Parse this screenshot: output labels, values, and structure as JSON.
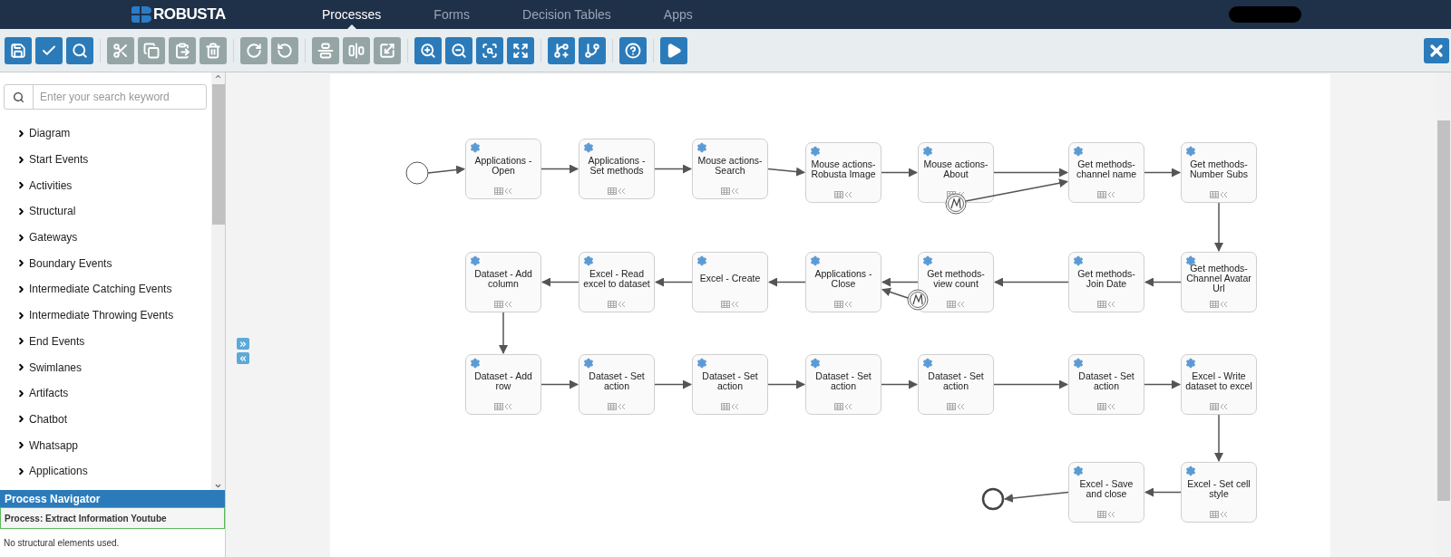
{
  "nav": {
    "brand": "ROBUSTA",
    "tabs": [
      {
        "label": "Processes",
        "selected": true
      },
      {
        "label": "Forms",
        "selected": false
      },
      {
        "label": "Decision Tables",
        "selected": false
      },
      {
        "label": "Apps",
        "selected": false
      }
    ]
  },
  "toolbar": {
    "groups": [
      [
        {
          "disabled": false
        },
        {
          "disabled": false
        },
        {
          "disabled": false
        }
      ],
      [
        {
          "disabled": true
        },
        {
          "disabled": true
        },
        {
          "disabled": true
        },
        {
          "disabled": true
        }
      ],
      [
        {
          "disabled": true
        },
        {
          "disabled": true
        }
      ],
      [
        {
          "disabled": true
        },
        {
          "disabled": true
        },
        {
          "disabled": true
        }
      ],
      [
        {
          "disabled": false
        },
        {
          "disabled": false
        },
        {
          "disabled": false
        },
        {
          "disabled": false
        }
      ],
      [
        {
          "disabled": false
        },
        {
          "disabled": false
        }
      ],
      [
        {
          "disabled": false
        }
      ],
      [
        {
          "disabled": false
        }
      ]
    ]
  },
  "sidebar": {
    "search": {
      "placeholder": "Enter your search keyword"
    },
    "items": [
      {
        "label": "Diagram",
        "expanded": false
      },
      {
        "label": "Start Events",
        "expanded": false
      },
      {
        "label": "Activities",
        "expanded": false
      },
      {
        "label": "Structural",
        "expanded": false
      },
      {
        "label": "Gateways",
        "expanded": false
      },
      {
        "label": "Boundary Events",
        "expanded": false
      },
      {
        "label": "Intermediate Catching Events",
        "expanded": false
      },
      {
        "label": "Intermediate Throwing Events",
        "expanded": false
      },
      {
        "label": "End Events",
        "expanded": false
      },
      {
        "label": "Swimlanes",
        "expanded": false
      },
      {
        "label": "Artifacts",
        "expanded": false
      },
      {
        "label": "Chatbot",
        "expanded": false
      },
      {
        "label": "Whatsapp",
        "expanded": false
      },
      {
        "label": "Applications",
        "expanded": false
      }
    ],
    "navigator": {
      "title": "Process Navigator",
      "process": "Process: Extract Information Youtube",
      "note": "No structural elements used."
    }
  },
  "diagram": {
    "elements": [
      {
        "kind": "start"
      },
      {
        "kind": "task",
        "label": "Applications - Open",
        "boundary_event": false
      },
      {
        "kind": "task",
        "label": "Applications - Set methods",
        "boundary_event": false
      },
      {
        "kind": "task",
        "label": "Mouse actions- Search",
        "boundary_event": false
      },
      {
        "kind": "task",
        "label": "Mouse actions- Robusta Image",
        "boundary_event": false
      },
      {
        "kind": "task",
        "label": "Mouse actions- About",
        "boundary_event": true
      },
      {
        "kind": "task",
        "label": "Get methods- channel name",
        "boundary_event": false
      },
      {
        "kind": "task",
        "label": "Get methods- Number Subs",
        "boundary_event": false
      },
      {
        "kind": "task",
        "label": "Dataset - Add column",
        "boundary_event": false
      },
      {
        "kind": "task",
        "label": "Excel - Read excel to dataset",
        "boundary_event": false
      },
      {
        "kind": "task",
        "label": "Excel - Create",
        "boundary_event": false
      },
      {
        "kind": "task",
        "label": "Applications - Close",
        "boundary_event": false
      },
      {
        "kind": "task",
        "label": "Get methods- view count",
        "boundary_event": true
      },
      {
        "kind": "task",
        "label": "Get methods- Join Date",
        "boundary_event": false
      },
      {
        "kind": "task",
        "label": "Get methods- Channel Avatar Url",
        "boundary_event": false
      },
      {
        "kind": "task",
        "label": "Dataset - Add row",
        "boundary_event": false
      },
      {
        "kind": "task",
        "label": "Dataset - Set action",
        "boundary_event": false
      },
      {
        "kind": "task",
        "label": "Dataset - Set action",
        "boundary_event": false
      },
      {
        "kind": "task",
        "label": "Dataset - Set action",
        "boundary_event": false
      },
      {
        "kind": "task",
        "label": "Dataset - Set action",
        "boundary_event": false
      },
      {
        "kind": "task",
        "label": "Dataset - Set action",
        "boundary_event": false
      },
      {
        "kind": "task",
        "label": "Excel - Write dataset to excel",
        "boundary_event": false
      },
      {
        "kind": "end"
      },
      {
        "kind": "task",
        "label": "Excel - Save and close",
        "boundary_event": false
      },
      {
        "kind": "task",
        "label": "Excel - Set cell style",
        "boundary_event": false
      }
    ]
  }
}
